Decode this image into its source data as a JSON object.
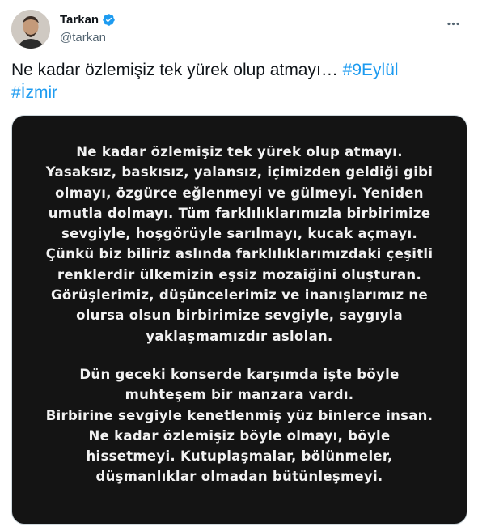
{
  "author": {
    "display_name": "Tarkan",
    "handle": "@tarkan",
    "verified": true
  },
  "tweet": {
    "text_before": "Ne kadar özlemişiz tek yürek olup atmayı…",
    "hashtags": [
      "#9Eylül",
      "#İzmir"
    ]
  },
  "media": {
    "paragraph1": [
      "Ne kadar özlemişiz tek yürek olup atmayı.",
      "Yasaksız, baskısız, yalansız, içimizden geldiği gibi",
      "olmayı, özgürce eğlenmeyi ve gülmeyi. Yeniden",
      "umutla dolmayı. Tüm farklılıklarımızla birbirimize",
      "sevgiyle, hoşgörüyle sarılmayı, kucak açmayı.",
      "Çünkü biz biliriz aslında farklılıklarımızdaki çeşitli",
      "renklerdir ülkemizin eşsiz mozaiğini oluşturan.",
      "Görüşlerimiz, düşüncelerimiz ve inanışlarımız ne",
      "olursa olsun birbirimize sevgiyle, saygıyla",
      "yaklaşmamızdır aslolan."
    ],
    "paragraph2": [
      "Dün geceki konserde karşımda işte böyle",
      "muhteşem bir manzara vardı.",
      "Birbirine sevgiyle kenetlenmiş yüz binlerce insan.",
      "Ne kadar özlemişiz böyle olmayı, böyle",
      "hissetmeyi. Kutuplaşmalar, bölünmeler,",
      "düşmanlıklar olmadan bütünleşmeyi."
    ]
  },
  "icons": {
    "verified": "verified-badge-icon",
    "more": "more-horizontal-icon"
  },
  "colors": {
    "accent": "#1d9bf0",
    "text": "#0f1419",
    "secondary": "#536471",
    "media_bg": "#141414"
  }
}
